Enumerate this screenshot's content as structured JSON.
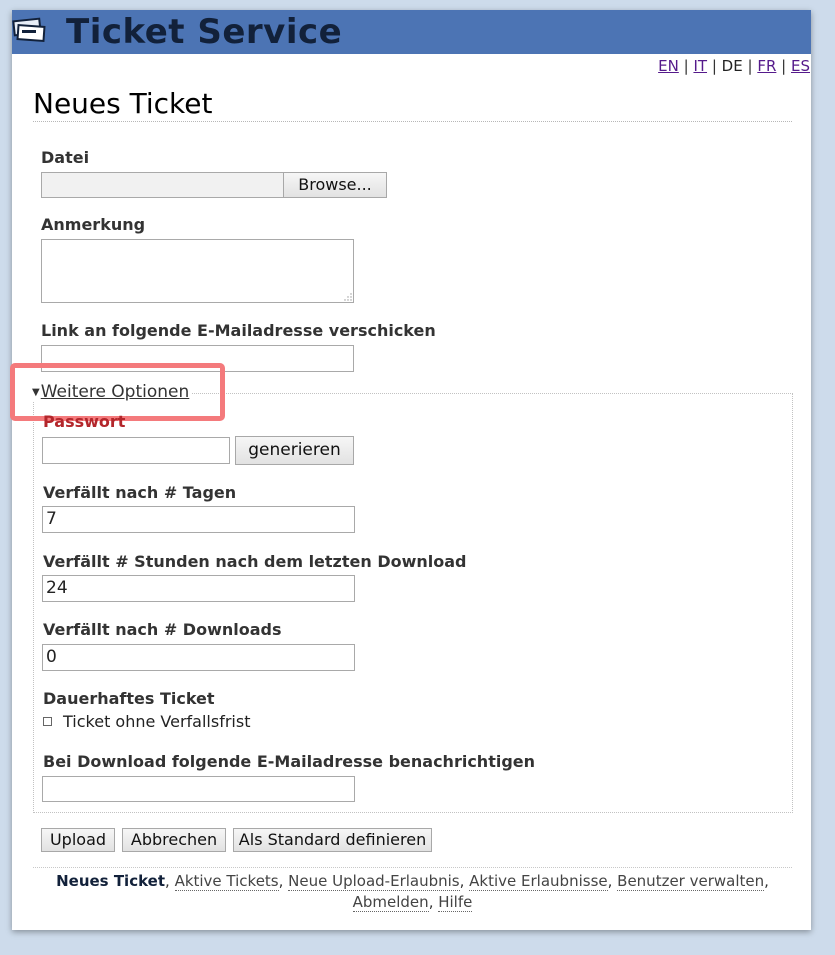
{
  "app": {
    "title": "Ticket Service"
  },
  "languages": {
    "items": [
      "EN",
      "IT",
      "DE",
      "FR",
      "ES"
    ],
    "active": "DE"
  },
  "page": {
    "title": "Neues Ticket"
  },
  "form": {
    "file": {
      "label": "Datei",
      "value": "",
      "browse_label": "Browse..."
    },
    "comment": {
      "label": "Anmerkung",
      "value": ""
    },
    "send_link": {
      "label": "Link an folgende E-Mailadresse verschicken",
      "value": ""
    },
    "more_options": {
      "label": "Weitere Optionen"
    },
    "password": {
      "label": "Passwort",
      "value": "",
      "generate_label": "generieren"
    },
    "expire_days": {
      "label": "Verfällt nach # Tagen",
      "value": "7"
    },
    "expire_hours": {
      "label": "Verfällt # Stunden nach dem letzten Download",
      "value": "24"
    },
    "expire_downloads": {
      "label": "Verfällt nach # Downloads",
      "value": "0"
    },
    "permanent": {
      "label": "Dauerhaftes Ticket",
      "checkbox_label": "Ticket ohne Verfallsfrist",
      "checked": false
    },
    "notify": {
      "label": "Bei Download folgende E-Mailadresse benachrichtigen",
      "value": ""
    },
    "buttons": {
      "upload": "Upload",
      "cancel": "Abbrechen",
      "set_default": "Als Standard definieren"
    }
  },
  "footer": {
    "current": "Neues Ticket",
    "links": [
      "Aktive Tickets",
      "Neue Upload-Erlaubnis",
      "Aktive Erlaubnisse",
      "Benutzer verwalten",
      "Abmelden",
      "Hilfe"
    ]
  },
  "colors": {
    "header_bg": "#4c74b4",
    "background": "#cddbeb",
    "error_label": "#b3262b",
    "highlight": "#f47a7c"
  }
}
